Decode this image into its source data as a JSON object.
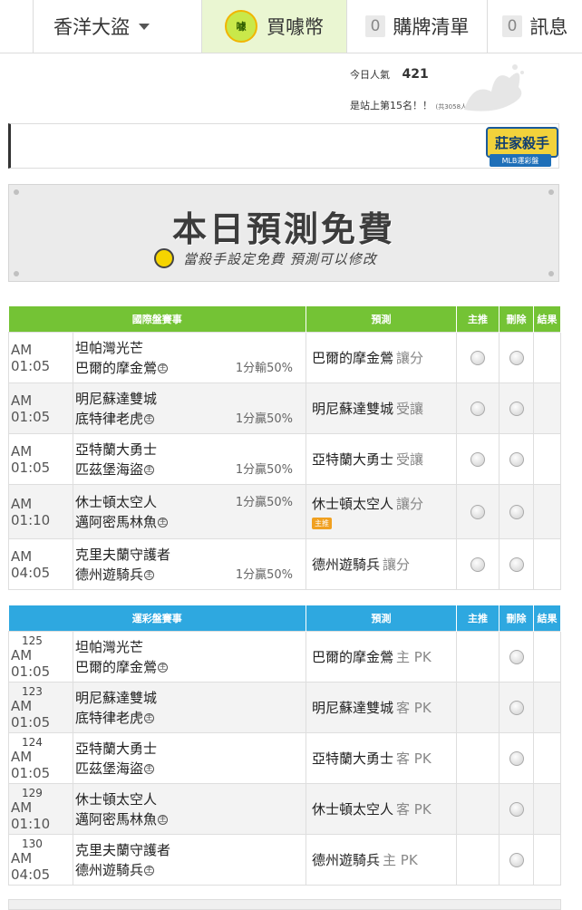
{
  "nav": {
    "user_name": "香洋大盜",
    "buy_coins": "買噱幣",
    "coin_icon_text": "噱",
    "cart_count": "0",
    "cart_label": "購牌清單",
    "msg_count": "0",
    "msg_label": "訊息"
  },
  "stats": {
    "popularity_label": "今日人氣",
    "popularity_value": "421",
    "rank_text": "是站上第15名！！",
    "rank_total": "(共3058人)"
  },
  "badge": {
    "title": "莊家殺手",
    "subtitle": "MLB運彩盤"
  },
  "promo": {
    "title": "本日預測免費",
    "subtitle": "當殺手設定免費 預測可以修改"
  },
  "intl_table": {
    "headers": [
      "國際盤賽事",
      "預測",
      "主推",
      "刪除",
      "結果"
    ],
    "home_mark": "主",
    "hot_tag": "主推",
    "rows": [
      {
        "time": "AM 01:05",
        "team1": "坦帕灣光芒",
        "team2": "巴爾的摩金鶯",
        "odds": "1分輸50%",
        "odds_pos": "bottom",
        "pred": "巴爾的摩金鶯",
        "pred_label": "讓分",
        "hot": false
      },
      {
        "time": "AM 01:05",
        "team1": "明尼蘇達雙城",
        "team2": "底特律老虎",
        "odds": "1分贏50%",
        "odds_pos": "bottom",
        "pred": "明尼蘇達雙城",
        "pred_label": "受讓",
        "hot": false
      },
      {
        "time": "AM 01:05",
        "team1": "亞特蘭大勇士",
        "team2": "匹茲堡海盜",
        "odds": "1分贏50%",
        "odds_pos": "bottom",
        "pred": "亞特蘭大勇士",
        "pred_label": "受讓",
        "hot": false
      },
      {
        "time": "AM 01:10",
        "team1": "休士頓太空人",
        "team2": "邁阿密馬林魚",
        "odds": "1分贏50%",
        "odds_pos": "top",
        "pred": "休士頓太空人",
        "pred_label": "讓分",
        "hot": true
      },
      {
        "time": "AM 04:05",
        "team1": "克里夫蘭守護者",
        "team2": "德州遊騎兵",
        "odds": "1分贏50%",
        "odds_pos": "bottom",
        "pred": "德州遊騎兵",
        "pred_label": "讓分",
        "hot": false
      }
    ]
  },
  "lottery_table": {
    "headers": [
      "運彩盤賽事",
      "預測",
      "主推",
      "刪除",
      "結果"
    ],
    "home_mark": "主",
    "rows": [
      {
        "code": "125",
        "time": "AM 01:05",
        "team1": "坦帕灣光芒",
        "team2": "巴爾的摩金鶯",
        "pred": "巴爾的摩金鶯",
        "pred_label": "主 PK"
      },
      {
        "code": "123",
        "time": "AM 01:05",
        "team1": "明尼蘇達雙城",
        "team2": "底特律老虎",
        "pred": "明尼蘇達雙城",
        "pred_label": "客 PK"
      },
      {
        "code": "124",
        "time": "AM 01:05",
        "team1": "亞特蘭大勇士",
        "team2": "匹茲堡海盜",
        "pred": "亞特蘭大勇士",
        "pred_label": "客 PK"
      },
      {
        "code": "129",
        "time": "AM 01:10",
        "team1": "休士頓太空人",
        "team2": "邁阿密馬林魚",
        "pred": "休士頓太空人",
        "pred_label": "客 PK"
      },
      {
        "code": "130",
        "time": "AM 04:05",
        "team1": "克里夫蘭守護者",
        "team2": "德州遊騎兵",
        "pred": "德州遊騎兵",
        "pred_label": "主 PK"
      }
    ]
  }
}
